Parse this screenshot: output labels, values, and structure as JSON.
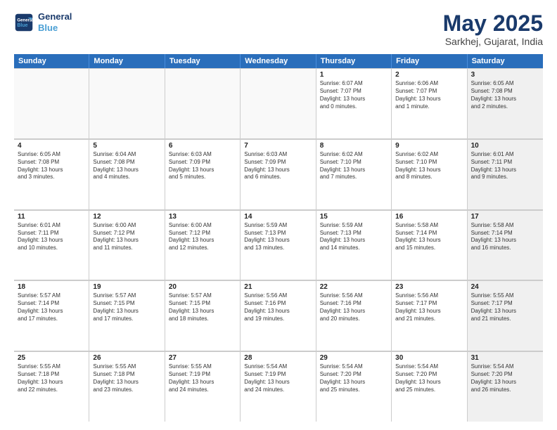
{
  "header": {
    "logo_line1": "General",
    "logo_line2": "Blue",
    "month_title": "May 2025",
    "location": "Sarkhej, Gujarat, India"
  },
  "weekdays": [
    "Sunday",
    "Monday",
    "Tuesday",
    "Wednesday",
    "Thursday",
    "Friday",
    "Saturday"
  ],
  "rows": [
    [
      {
        "day": "",
        "text": "",
        "empty": true
      },
      {
        "day": "",
        "text": "",
        "empty": true
      },
      {
        "day": "",
        "text": "",
        "empty": true
      },
      {
        "day": "",
        "text": "",
        "empty": true
      },
      {
        "day": "1",
        "text": "Sunrise: 6:07 AM\nSunset: 7:07 PM\nDaylight: 13 hours\nand 0 minutes.",
        "empty": false
      },
      {
        "day": "2",
        "text": "Sunrise: 6:06 AM\nSunset: 7:07 PM\nDaylight: 13 hours\nand 1 minute.",
        "empty": false
      },
      {
        "day": "3",
        "text": "Sunrise: 6:05 AM\nSunset: 7:08 PM\nDaylight: 13 hours\nand 2 minutes.",
        "empty": false,
        "shaded": true
      }
    ],
    [
      {
        "day": "4",
        "text": "Sunrise: 6:05 AM\nSunset: 7:08 PM\nDaylight: 13 hours\nand 3 minutes.",
        "empty": false
      },
      {
        "day": "5",
        "text": "Sunrise: 6:04 AM\nSunset: 7:08 PM\nDaylight: 13 hours\nand 4 minutes.",
        "empty": false
      },
      {
        "day": "6",
        "text": "Sunrise: 6:03 AM\nSunset: 7:09 PM\nDaylight: 13 hours\nand 5 minutes.",
        "empty": false
      },
      {
        "day": "7",
        "text": "Sunrise: 6:03 AM\nSunset: 7:09 PM\nDaylight: 13 hours\nand 6 minutes.",
        "empty": false
      },
      {
        "day": "8",
        "text": "Sunrise: 6:02 AM\nSunset: 7:10 PM\nDaylight: 13 hours\nand 7 minutes.",
        "empty": false
      },
      {
        "day": "9",
        "text": "Sunrise: 6:02 AM\nSunset: 7:10 PM\nDaylight: 13 hours\nand 8 minutes.",
        "empty": false
      },
      {
        "day": "10",
        "text": "Sunrise: 6:01 AM\nSunset: 7:11 PM\nDaylight: 13 hours\nand 9 minutes.",
        "empty": false,
        "shaded": true
      }
    ],
    [
      {
        "day": "11",
        "text": "Sunrise: 6:01 AM\nSunset: 7:11 PM\nDaylight: 13 hours\nand 10 minutes.",
        "empty": false
      },
      {
        "day": "12",
        "text": "Sunrise: 6:00 AM\nSunset: 7:12 PM\nDaylight: 13 hours\nand 11 minutes.",
        "empty": false
      },
      {
        "day": "13",
        "text": "Sunrise: 6:00 AM\nSunset: 7:12 PM\nDaylight: 13 hours\nand 12 minutes.",
        "empty": false
      },
      {
        "day": "14",
        "text": "Sunrise: 5:59 AM\nSunset: 7:13 PM\nDaylight: 13 hours\nand 13 minutes.",
        "empty": false
      },
      {
        "day": "15",
        "text": "Sunrise: 5:59 AM\nSunset: 7:13 PM\nDaylight: 13 hours\nand 14 minutes.",
        "empty": false
      },
      {
        "day": "16",
        "text": "Sunrise: 5:58 AM\nSunset: 7:14 PM\nDaylight: 13 hours\nand 15 minutes.",
        "empty": false
      },
      {
        "day": "17",
        "text": "Sunrise: 5:58 AM\nSunset: 7:14 PM\nDaylight: 13 hours\nand 16 minutes.",
        "empty": false,
        "shaded": true
      }
    ],
    [
      {
        "day": "18",
        "text": "Sunrise: 5:57 AM\nSunset: 7:14 PM\nDaylight: 13 hours\nand 17 minutes.",
        "empty": false
      },
      {
        "day": "19",
        "text": "Sunrise: 5:57 AM\nSunset: 7:15 PM\nDaylight: 13 hours\nand 17 minutes.",
        "empty": false
      },
      {
        "day": "20",
        "text": "Sunrise: 5:57 AM\nSunset: 7:15 PM\nDaylight: 13 hours\nand 18 minutes.",
        "empty": false
      },
      {
        "day": "21",
        "text": "Sunrise: 5:56 AM\nSunset: 7:16 PM\nDaylight: 13 hours\nand 19 minutes.",
        "empty": false
      },
      {
        "day": "22",
        "text": "Sunrise: 5:56 AM\nSunset: 7:16 PM\nDaylight: 13 hours\nand 20 minutes.",
        "empty": false
      },
      {
        "day": "23",
        "text": "Sunrise: 5:56 AM\nSunset: 7:17 PM\nDaylight: 13 hours\nand 21 minutes.",
        "empty": false
      },
      {
        "day": "24",
        "text": "Sunrise: 5:55 AM\nSunset: 7:17 PM\nDaylight: 13 hours\nand 21 minutes.",
        "empty": false,
        "shaded": true
      }
    ],
    [
      {
        "day": "25",
        "text": "Sunrise: 5:55 AM\nSunset: 7:18 PM\nDaylight: 13 hours\nand 22 minutes.",
        "empty": false
      },
      {
        "day": "26",
        "text": "Sunrise: 5:55 AM\nSunset: 7:18 PM\nDaylight: 13 hours\nand 23 minutes.",
        "empty": false
      },
      {
        "day": "27",
        "text": "Sunrise: 5:55 AM\nSunset: 7:19 PM\nDaylight: 13 hours\nand 24 minutes.",
        "empty": false
      },
      {
        "day": "28",
        "text": "Sunrise: 5:54 AM\nSunset: 7:19 PM\nDaylight: 13 hours\nand 24 minutes.",
        "empty": false
      },
      {
        "day": "29",
        "text": "Sunrise: 5:54 AM\nSunset: 7:20 PM\nDaylight: 13 hours\nand 25 minutes.",
        "empty": false
      },
      {
        "day": "30",
        "text": "Sunrise: 5:54 AM\nSunset: 7:20 PM\nDaylight: 13 hours\nand 25 minutes.",
        "empty": false
      },
      {
        "day": "31",
        "text": "Sunrise: 5:54 AM\nSunset: 7:20 PM\nDaylight: 13 hours\nand 26 minutes.",
        "empty": false,
        "shaded": true
      }
    ]
  ]
}
